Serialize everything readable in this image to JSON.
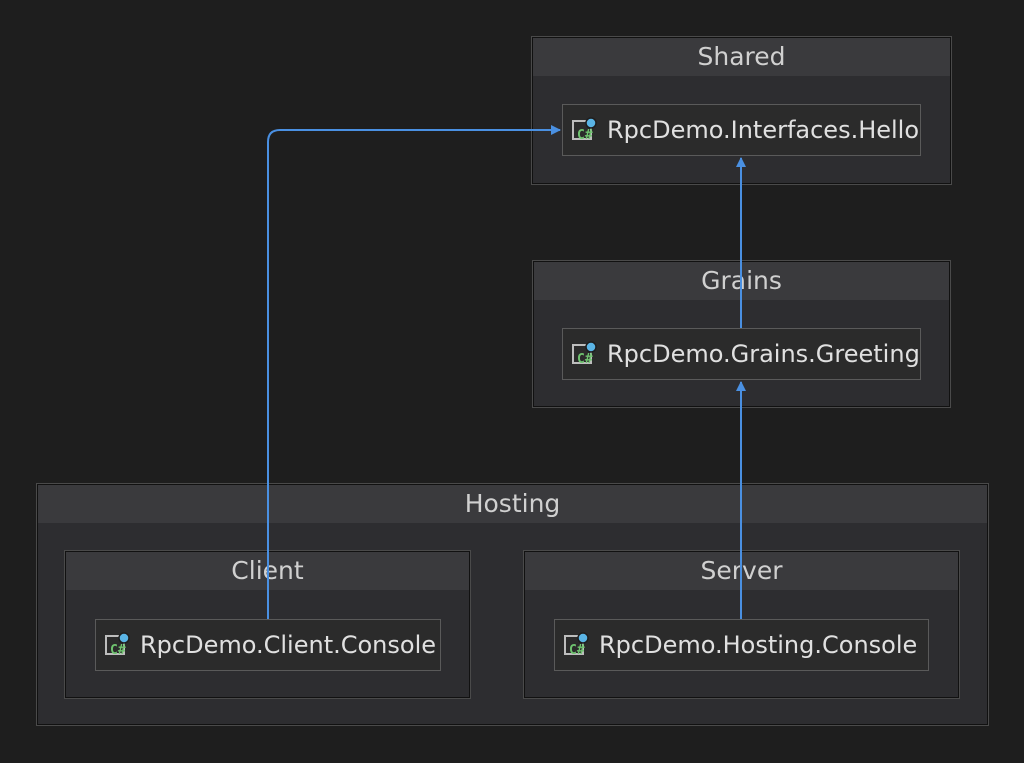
{
  "groups": {
    "shared": "Shared",
    "grains": "Grains",
    "hosting": "Hosting",
    "client": "Client",
    "server": "Server"
  },
  "nodes": {
    "interfaces_hello": "RpcDemo.Interfaces.Hello",
    "grains_greeting": "RpcDemo.Grains.Greeting",
    "client_console": "RpcDemo.Client.Console",
    "hosting_console": "RpcDemo.Hosting.Console"
  },
  "icon": "csharp-project-icon",
  "colors": {
    "edge": "#4a90e2",
    "icon_green": "#6fc36f",
    "icon_blue": "#5ab4e5"
  }
}
